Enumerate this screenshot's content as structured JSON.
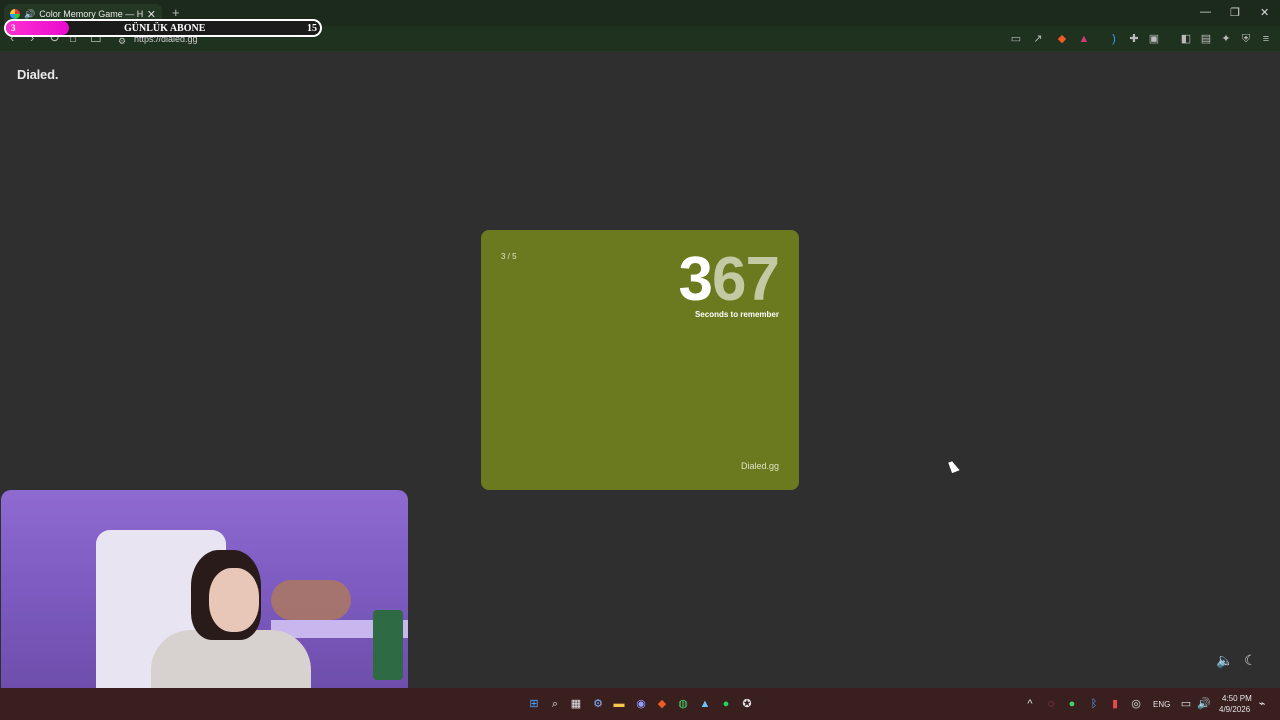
{
  "browser": {
    "tab_title": "Color Memory Game — How",
    "url": "https://dialed.gg"
  },
  "overlay": {
    "start": "3",
    "label": "GÜNLÜK ABONE",
    "goal": "15",
    "progress_fraction": 0.2
  },
  "page": {
    "logo": "Dialed.",
    "card": {
      "round": "3 / 5",
      "timer_main": "3",
      "timer_rest": "67",
      "sublabel": "Seconds to remember",
      "brand": "Dialed.gg",
      "color": "#6b7a1f"
    }
  },
  "taskbar": {
    "lang": "ENG",
    "time": "4:50 PM",
    "date": "4/9/2026"
  },
  "icons": {
    "browser_toolbar": [
      "back-icon",
      "forward-icon",
      "reload-icon",
      "home-icon",
      "bookmark-icon"
    ],
    "extensions": [
      "cast-icon",
      "share-icon",
      "brave-shield-icon",
      "rewards-icon",
      "sound-icon",
      "extensions-icon",
      "screenshot-icon",
      "sidebar-icon",
      "wallet-icon",
      "leo-icon",
      "vpn-icon",
      "menu-icon"
    ],
    "taskbar": [
      "start-icon",
      "search-icon",
      "taskview-icon",
      "settings-icon",
      "files-icon",
      "discord-icon",
      "brave-icon",
      "whatsapp-icon",
      "photos-icon",
      "spotify-icon",
      "misc-icon"
    ]
  }
}
